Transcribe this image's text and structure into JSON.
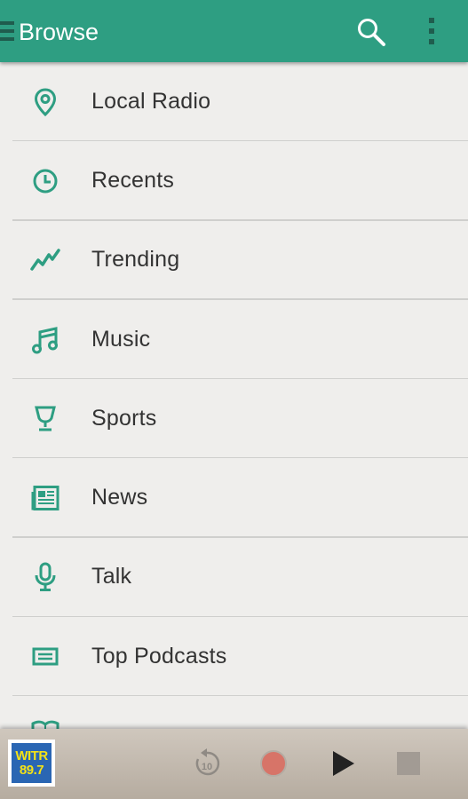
{
  "appbar": {
    "title": "Browse",
    "color": "#2e9e82",
    "search_icon": "search-icon",
    "menu_icon": "overflow-menu-icon"
  },
  "menu": {
    "items": [
      {
        "label": "Local Radio",
        "icon": "location-pin-icon"
      },
      {
        "label": "Recents",
        "icon": "clock-icon"
      },
      {
        "label": "Trending",
        "icon": "trending-icon"
      },
      {
        "label": "Music",
        "icon": "music-note-icon"
      },
      {
        "label": "Sports",
        "icon": "trophy-icon"
      },
      {
        "label": "News",
        "icon": "newspaper-icon"
      },
      {
        "label": "Talk",
        "icon": "microphone-icon"
      },
      {
        "label": "Top Podcasts",
        "icon": "podcast-icon"
      }
    ],
    "icon_color": "#2e9e82"
  },
  "player": {
    "station_logo_line1": "WITR",
    "station_logo_line2": "89.7",
    "rewind_label": "10"
  }
}
